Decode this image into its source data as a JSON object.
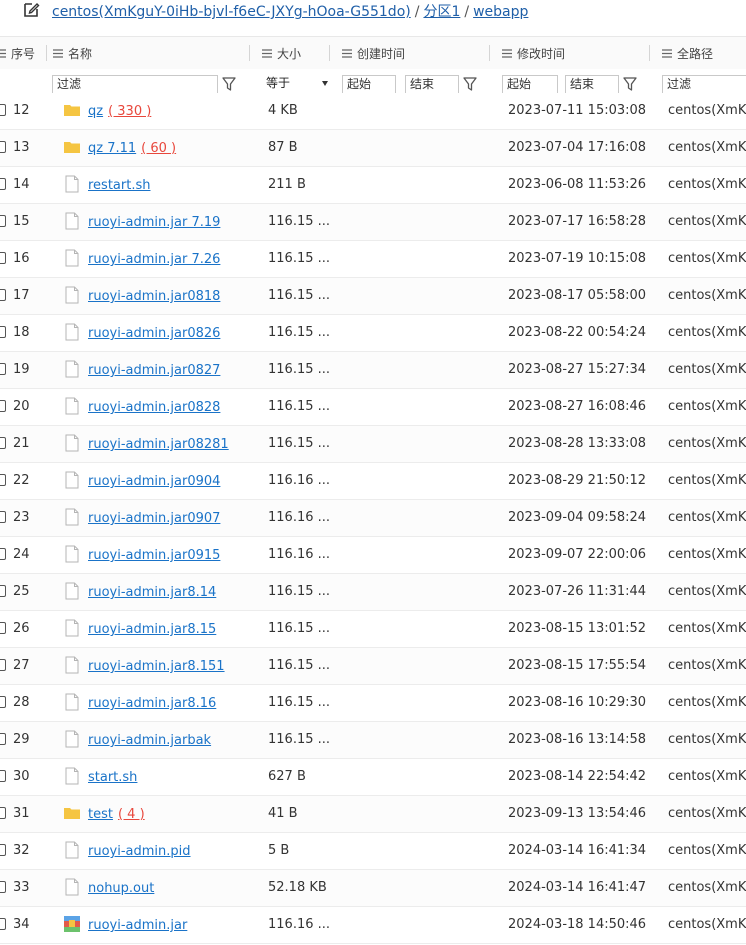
{
  "breadcrumb": {
    "root": "centos(XmKguY-0iHb-bjvl-f6eC-JXYg-hOoa-G551do)",
    "partition": "分区1",
    "folder": "webapp",
    "separator": "/"
  },
  "columns": {
    "index": "序号",
    "name": "名称",
    "size": "大小",
    "created": "创建时间",
    "modified": "修改时间",
    "fullpath": "全路径"
  },
  "filters": {
    "name_placeholder": "过滤",
    "size_operator": "等于",
    "created_start": "起始",
    "created_end": "结束",
    "modified_start": "起始",
    "modified_end": "结束",
    "fullpath_placeholder": "过滤"
  },
  "colors": {
    "link": "#1a73c8",
    "count": "#e8473c",
    "folder": "#f5c542"
  },
  "rows": [
    {
      "index": "12",
      "type": "folder",
      "name": "qz",
      "count": "( 330 )",
      "size": "4 KB",
      "modified": "2023-07-11 15:03:08",
      "path": "centos(XmKg"
    },
    {
      "index": "13",
      "type": "folder",
      "name": "qz 7.11",
      "count": "( 60 )",
      "size": "87 B",
      "modified": "2023-07-04 17:16:08",
      "path": "centos(XmKg"
    },
    {
      "index": "14",
      "type": "file",
      "name": "restart.sh",
      "count": "",
      "size": "211 B",
      "modified": "2023-06-08 11:53:26",
      "path": "centos(XmKg"
    },
    {
      "index": "15",
      "type": "file",
      "name": "ruoyi-admin.jar 7.19",
      "count": "",
      "size": "116.15 ...",
      "modified": "2023-07-17 16:58:28",
      "path": "centos(XmKg"
    },
    {
      "index": "16",
      "type": "file",
      "name": "ruoyi-admin.jar 7.26",
      "count": "",
      "size": "116.15 ...",
      "modified": "2023-07-19 10:15:08",
      "path": "centos(XmKg"
    },
    {
      "index": "17",
      "type": "file",
      "name": "ruoyi-admin.jar0818",
      "count": "",
      "size": "116.15 ...",
      "modified": "2023-08-17 05:58:00",
      "path": "centos(XmKg"
    },
    {
      "index": "18",
      "type": "file",
      "name": "ruoyi-admin.jar0826",
      "count": "",
      "size": "116.15 ...",
      "modified": "2023-08-22 00:54:24",
      "path": "centos(XmKg"
    },
    {
      "index": "19",
      "type": "file",
      "name": "ruoyi-admin.jar0827",
      "count": "",
      "size": "116.15 ...",
      "modified": "2023-08-27 15:27:34",
      "path": "centos(XmKg"
    },
    {
      "index": "20",
      "type": "file",
      "name": "ruoyi-admin.jar0828",
      "count": "",
      "size": "116.15 ...",
      "modified": "2023-08-27 16:08:46",
      "path": "centos(XmKg"
    },
    {
      "index": "21",
      "type": "file",
      "name": "ruoyi-admin.jar08281",
      "count": "",
      "size": "116.15 ...",
      "modified": "2023-08-28 13:33:08",
      "path": "centos(XmKg"
    },
    {
      "index": "22",
      "type": "file",
      "name": "ruoyi-admin.jar0904",
      "count": "",
      "size": "116.16 ...",
      "modified": "2023-08-29 21:50:12",
      "path": "centos(XmKg"
    },
    {
      "index": "23",
      "type": "file",
      "name": "ruoyi-admin.jar0907",
      "count": "",
      "size": "116.16 ...",
      "modified": "2023-09-04 09:58:24",
      "path": "centos(XmKg"
    },
    {
      "index": "24",
      "type": "file",
      "name": "ruoyi-admin.jar0915",
      "count": "",
      "size": "116.16 ...",
      "modified": "2023-09-07 22:00:06",
      "path": "centos(XmKg"
    },
    {
      "index": "25",
      "type": "file",
      "name": "ruoyi-admin.jar8.14",
      "count": "",
      "size": "116.15 ...",
      "modified": "2023-07-26 11:31:44",
      "path": "centos(XmKg"
    },
    {
      "index": "26",
      "type": "file",
      "name": "ruoyi-admin.jar8.15",
      "count": "",
      "size": "116.15 ...",
      "modified": "2023-08-15 13:01:52",
      "path": "centos(XmKg"
    },
    {
      "index": "27",
      "type": "file",
      "name": "ruoyi-admin.jar8.151",
      "count": "",
      "size": "116.15 ...",
      "modified": "2023-08-15 17:55:54",
      "path": "centos(XmKg"
    },
    {
      "index": "28",
      "type": "file",
      "name": "ruoyi-admin.jar8.16",
      "count": "",
      "size": "116.15 ...",
      "modified": "2023-08-16 10:29:30",
      "path": "centos(XmKg"
    },
    {
      "index": "29",
      "type": "file",
      "name": "ruoyi-admin.jarbak",
      "count": "",
      "size": "116.15 ...",
      "modified": "2023-08-16 13:14:58",
      "path": "centos(XmKg"
    },
    {
      "index": "30",
      "type": "file",
      "name": "start.sh",
      "count": "",
      "size": "627 B",
      "modified": "2023-08-14 22:54:42",
      "path": "centos(XmKg"
    },
    {
      "index": "31",
      "type": "folder",
      "name": "test",
      "count": "( 4 )",
      "size": "41 B",
      "modified": "2023-09-13 13:54:46",
      "path": "centos(XmKg"
    },
    {
      "index": "32",
      "type": "file",
      "name": "ruoyi-admin.pid",
      "count": "",
      "size": "5 B",
      "modified": "2024-03-14 16:41:34",
      "path": "centos(XmKg"
    },
    {
      "index": "33",
      "type": "file",
      "name": "nohup.out",
      "count": "",
      "size": "52.18 KB",
      "modified": "2024-03-14 16:41:47",
      "path": "centos(XmKg"
    },
    {
      "index": "34",
      "type": "archive",
      "name": "ruoyi-admin.jar",
      "count": "",
      "size": "116.16 ...",
      "modified": "2024-03-18 14:50:46",
      "path": "centos(XmKg"
    }
  ]
}
